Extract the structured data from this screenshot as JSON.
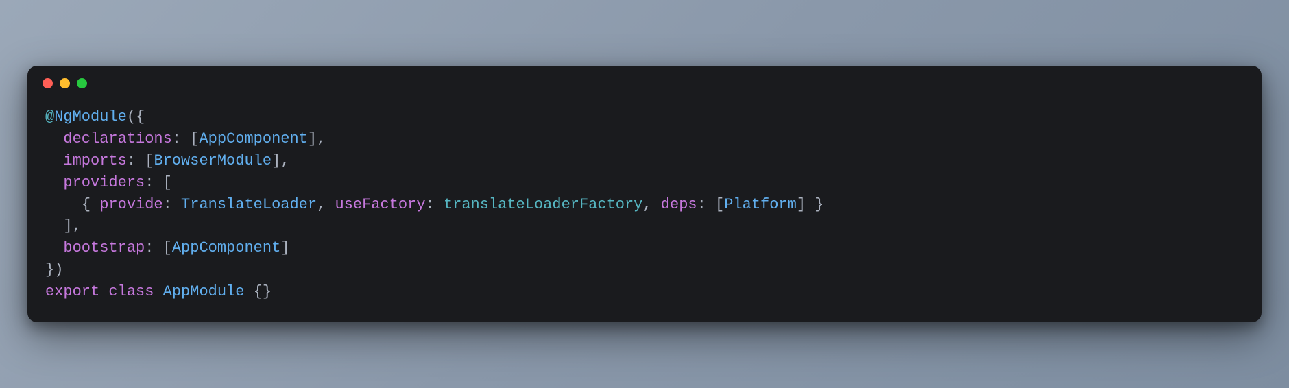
{
  "window": {
    "dots": [
      "red",
      "yellow",
      "green"
    ]
  },
  "code": {
    "tokens": [
      {
        "cls": "tok-decorator",
        "t": "@"
      },
      {
        "cls": "tok-type",
        "t": "NgModule"
      },
      {
        "cls": "tok-punct",
        "t": "({"
      },
      {
        "cls": "",
        "t": "\n  "
      },
      {
        "cls": "tok-prop",
        "t": "declarations"
      },
      {
        "cls": "tok-punct",
        "t": ": ["
      },
      {
        "cls": "tok-type",
        "t": "AppComponent"
      },
      {
        "cls": "tok-punct",
        "t": "],"
      },
      {
        "cls": "",
        "t": "\n  "
      },
      {
        "cls": "tok-prop",
        "t": "imports"
      },
      {
        "cls": "tok-punct",
        "t": ": ["
      },
      {
        "cls": "tok-type",
        "t": "BrowserModule"
      },
      {
        "cls": "tok-punct",
        "t": "],"
      },
      {
        "cls": "",
        "t": "\n  "
      },
      {
        "cls": "tok-prop",
        "t": "providers"
      },
      {
        "cls": "tok-punct",
        "t": ": ["
      },
      {
        "cls": "",
        "t": "\n    "
      },
      {
        "cls": "tok-punct",
        "t": "{ "
      },
      {
        "cls": "tok-prop",
        "t": "provide"
      },
      {
        "cls": "tok-punct",
        "t": ": "
      },
      {
        "cls": "tok-type",
        "t": "TranslateLoader"
      },
      {
        "cls": "tok-punct",
        "t": ", "
      },
      {
        "cls": "tok-prop",
        "t": "useFactory"
      },
      {
        "cls": "tok-punct",
        "t": ": "
      },
      {
        "cls": "tok-ident",
        "t": "translateLoaderFactory"
      },
      {
        "cls": "tok-punct",
        "t": ", "
      },
      {
        "cls": "tok-prop",
        "t": "deps"
      },
      {
        "cls": "tok-punct",
        "t": ": ["
      },
      {
        "cls": "tok-type",
        "t": "Platform"
      },
      {
        "cls": "tok-punct",
        "t": "] }"
      },
      {
        "cls": "",
        "t": "\n  "
      },
      {
        "cls": "tok-punct",
        "t": "],"
      },
      {
        "cls": "",
        "t": "\n  "
      },
      {
        "cls": "tok-prop",
        "t": "bootstrap"
      },
      {
        "cls": "tok-punct",
        "t": ": ["
      },
      {
        "cls": "tok-type",
        "t": "AppComponent"
      },
      {
        "cls": "tok-punct",
        "t": "]"
      },
      {
        "cls": "",
        "t": "\n"
      },
      {
        "cls": "tok-punct",
        "t": "})"
      },
      {
        "cls": "",
        "t": "\n"
      },
      {
        "cls": "tok-keyword",
        "t": "export"
      },
      {
        "cls": "tok-plain",
        "t": " "
      },
      {
        "cls": "tok-keyword",
        "t": "class"
      },
      {
        "cls": "tok-plain",
        "t": " "
      },
      {
        "cls": "tok-type",
        "t": "AppModule"
      },
      {
        "cls": "tok-plain",
        "t": " "
      },
      {
        "cls": "tok-punct",
        "t": "{}"
      }
    ]
  }
}
